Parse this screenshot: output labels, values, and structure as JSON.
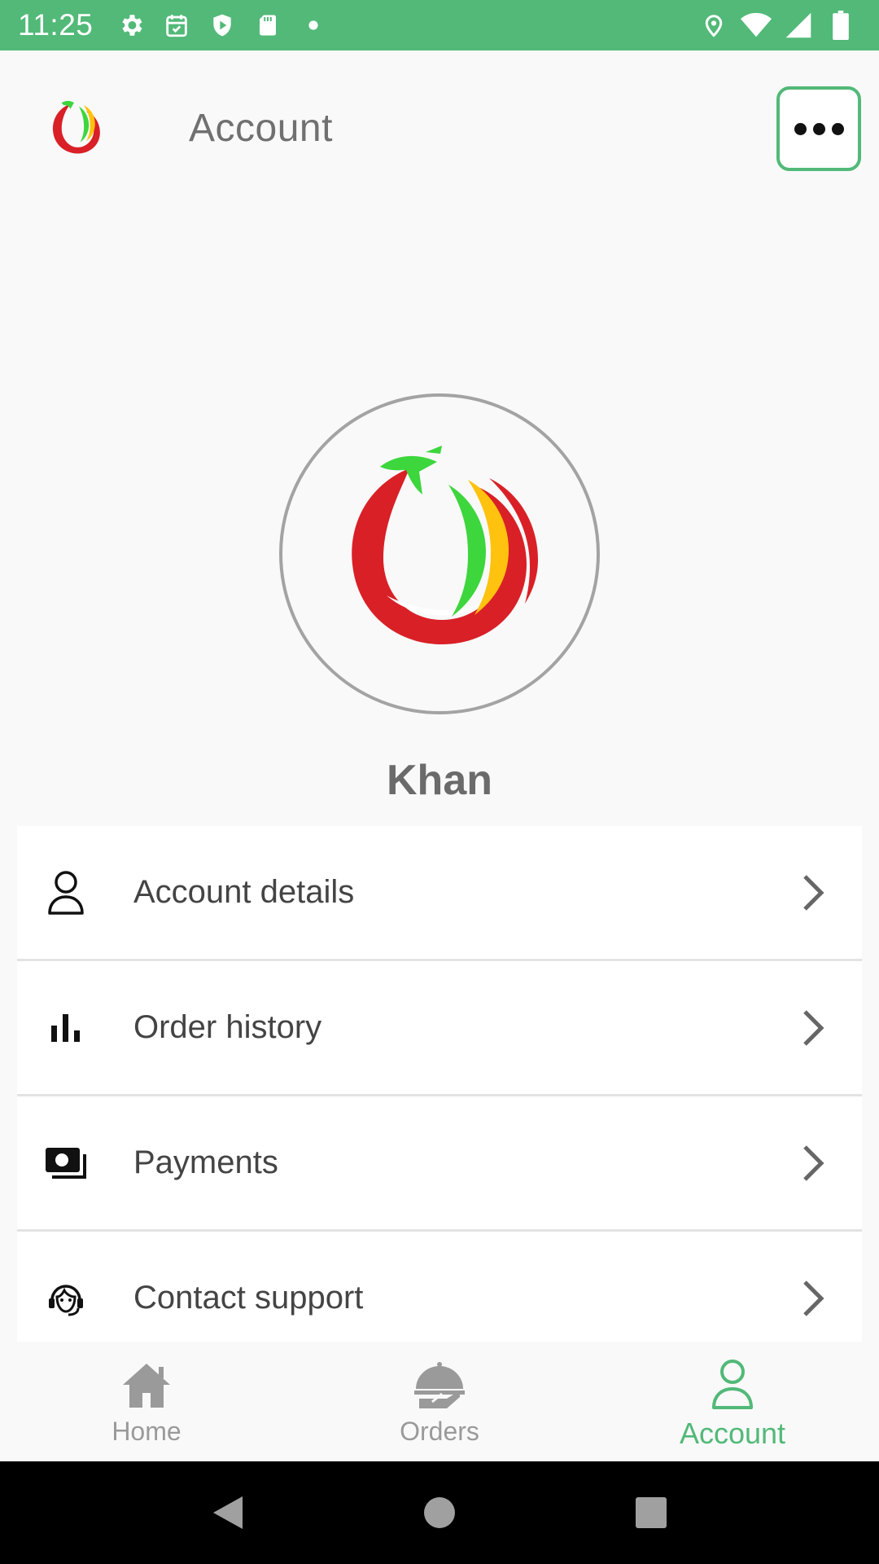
{
  "status_bar": {
    "time": "11:25",
    "background": "#52b978"
  },
  "app_bar": {
    "title": "Account"
  },
  "profile": {
    "name": "Khan"
  },
  "menu": {
    "items": [
      {
        "label": "Account details",
        "icon": "user-icon"
      },
      {
        "label": "Order history",
        "icon": "bar-chart-icon"
      },
      {
        "label": "Payments",
        "icon": "payments-icon"
      },
      {
        "label": "Contact support",
        "icon": "support-agent-icon"
      }
    ]
  },
  "bottom_nav": {
    "tabs": [
      {
        "label": "Home",
        "icon": "home-icon",
        "active": false
      },
      {
        "label": "Orders",
        "icon": "orders-icon",
        "active": false
      },
      {
        "label": "Account",
        "icon": "user-icon",
        "active": true
      }
    ]
  },
  "colors": {
    "accent": "#52b978",
    "logo_red": "#d92027",
    "logo_green": "#3dd63d",
    "logo_yellow": "#ffc20e"
  }
}
